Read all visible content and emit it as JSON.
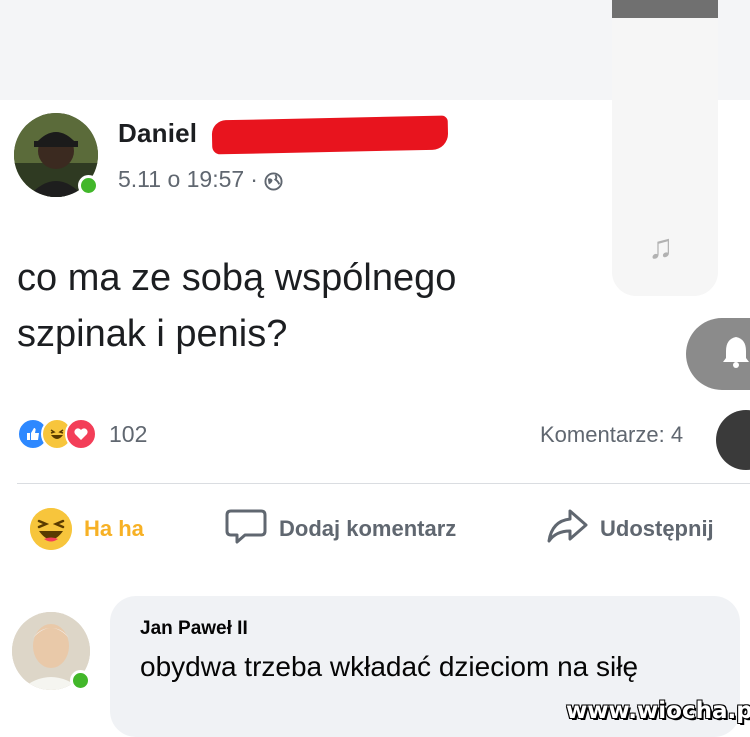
{
  "post": {
    "author_name": "Daniel",
    "date": "5.11 o 19:57",
    "separator": "·",
    "text_line1": "co ma ze sobą wspólnego",
    "text_line2": "szpinak i penis?",
    "reactions_count": "102",
    "comments_label": "Komentarze: 4"
  },
  "actions": {
    "haha_label": "Ha ha",
    "comment_label": "Dodaj komentarz",
    "share_label": "Udostępnij"
  },
  "comment": {
    "author": "Jan Paweł II",
    "text": "obydwa trzeba wkładać dzieciom na siłę"
  },
  "watermark": "www.wiocha.pl",
  "icons": {
    "globe": "globe-icon",
    "like": "like-icon",
    "haha": "haha-icon",
    "love": "love-icon",
    "comment": "comment-icon",
    "share": "share-icon",
    "music": "music-note-icon",
    "bell": "bell-icon"
  },
  "colors": {
    "like_blue": "#2d88ff",
    "haha_yellow": "#f7c53c",
    "love_red": "#f33e58",
    "online_green": "#42b72a",
    "redaction_red": "#e8141e"
  }
}
